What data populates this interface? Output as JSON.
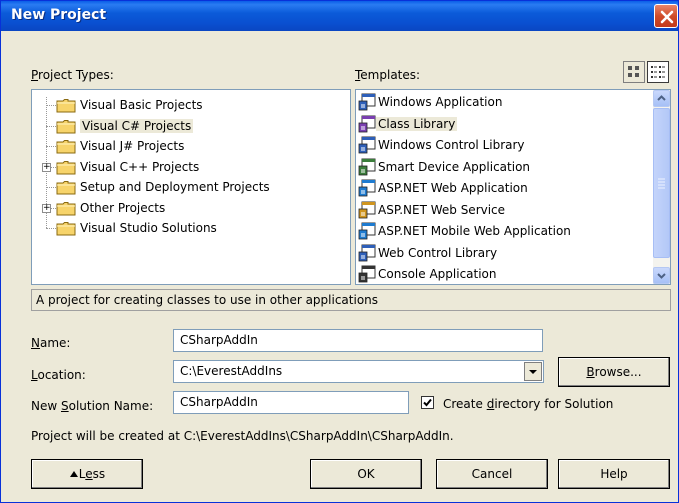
{
  "window": {
    "title": "New Project"
  },
  "labels": {
    "project_types": "Project Types:",
    "templates": "Templates:",
    "name": "Name:",
    "location": "Location:",
    "solution_name": "New Solution Name:",
    "create_dir": "Create directory for Solution"
  },
  "project_types": [
    {
      "label": "Visual Basic Projects",
      "expandable": false,
      "selected": false
    },
    {
      "label": "Visual C# Projects",
      "expandable": false,
      "selected": true
    },
    {
      "label": "Visual J# Projects",
      "expandable": false,
      "selected": false
    },
    {
      "label": "Visual C++ Projects",
      "expandable": true,
      "selected": false
    },
    {
      "label": "Setup and Deployment Projects",
      "expandable": false,
      "selected": false
    },
    {
      "label": "Other Projects",
      "expandable": true,
      "selected": false
    },
    {
      "label": "Visual Studio Solutions",
      "expandable": false,
      "selected": false
    }
  ],
  "templates": [
    {
      "label": "Windows Application",
      "icon": "windows-app-icon",
      "selected": false
    },
    {
      "label": "Class Library",
      "icon": "class-library-icon",
      "selected": true
    },
    {
      "label": "Windows Control Library",
      "icon": "control-library-icon",
      "selected": false
    },
    {
      "label": "Smart Device Application",
      "icon": "smart-device-icon",
      "selected": false
    },
    {
      "label": "ASP.NET Web Application",
      "icon": "web-app-icon",
      "selected": false
    },
    {
      "label": "ASP.NET Web Service",
      "icon": "web-service-icon",
      "selected": false
    },
    {
      "label": "ASP.NET Mobile Web Application",
      "icon": "mobile-web-icon",
      "selected": false
    },
    {
      "label": "Web Control Library",
      "icon": "web-control-icon",
      "selected": false
    },
    {
      "label": "Console Application",
      "icon": "console-app-icon",
      "selected": false
    }
  ],
  "description": "A project for creating classes to use in other applications",
  "fields": {
    "name_value": "CSharpAddIn",
    "location_value": "C:\\EverestAddIns",
    "solution_value": "CSharpAddIn",
    "create_dir_checked": true
  },
  "path_info": "Project will be created at C:\\EverestAddIns\\CSharpAddIn\\CSharpAddIn.",
  "buttons": {
    "browse": "Browse...",
    "less": "Less",
    "ok": "OK",
    "cancel": "Cancel",
    "help": "Help"
  },
  "colors": {
    "titlebar": "#0a5ee8",
    "dialog_bg": "#ece9d8",
    "close": "#d04d2a"
  }
}
